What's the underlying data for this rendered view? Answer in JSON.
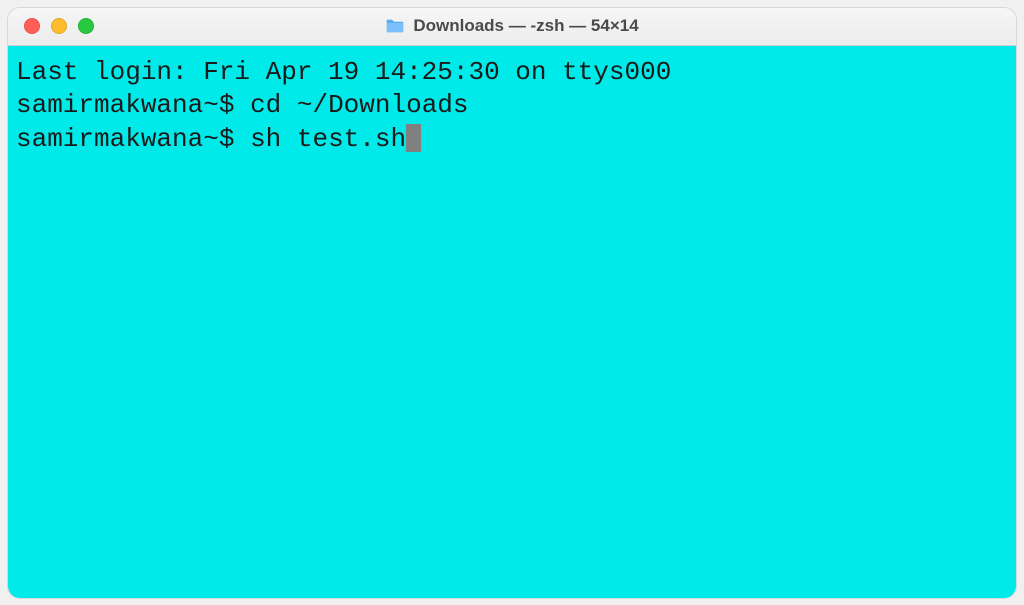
{
  "window": {
    "title": "Downloads — -zsh — 54×14"
  },
  "terminal": {
    "last_login": "Last login: Fri Apr 19 14:25:30 on ttys000",
    "lines": [
      {
        "prompt_user": "samirmakwana",
        "prompt_symbol": "~$",
        "command": "cd ~/Downloads"
      },
      {
        "prompt_user": "samirmakwana",
        "prompt_symbol": "~$",
        "command": "sh test.sh"
      }
    ]
  },
  "colors": {
    "terminal_bg": "#00eaea",
    "text": "#1a1a1a",
    "cursor": "#808080"
  }
}
